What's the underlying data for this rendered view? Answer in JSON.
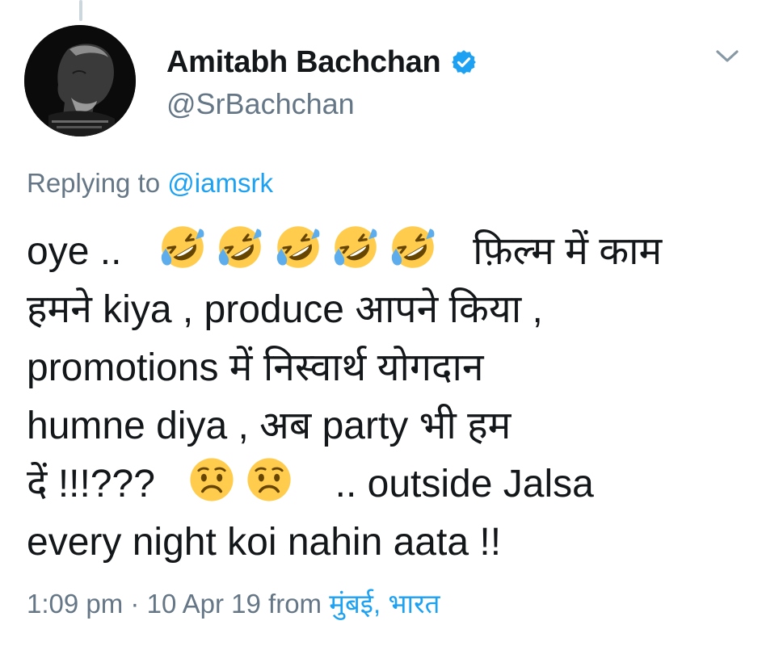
{
  "author": {
    "display_name": "Amitabh Bachchan",
    "handle": "@SrBachchan",
    "verified": true
  },
  "reply": {
    "prefix": "Replying to",
    "mention": "@iamsrk"
  },
  "tweet": {
    "line1_a": "oye ..",
    "line1_b": "फ़िल्म में काम",
    "line2": "हमने kiya , produce आपने किया ,",
    "line3": "promotions में निस्वार्थ  योगदान",
    "line4": "humne diya , अब party भी हम",
    "line5_a": "दें  !!!???",
    "line5_b": ".. outside Jalsa",
    "line6": "every night koi nahin aata  !!",
    "emojis": [
      "rolling-on-floor-laughing",
      "rolling-on-floor-laughing",
      "rolling-on-floor-laughing",
      "rolling-on-floor-laughing",
      "rolling-on-floor-laughing",
      "worried-face",
      "worried-face"
    ]
  },
  "meta": {
    "time": "1:09 pm",
    "separator": "·",
    "date": "10 Apr 19",
    "from": "from",
    "location": "मुंबई, भारत"
  },
  "colors": {
    "text": "#14171a",
    "secondary": "#657786",
    "link": "#1da1f2",
    "verified": "#1da1f2",
    "emoji_face": "#ffcc4d",
    "emoji_tear": "#5dadec"
  }
}
